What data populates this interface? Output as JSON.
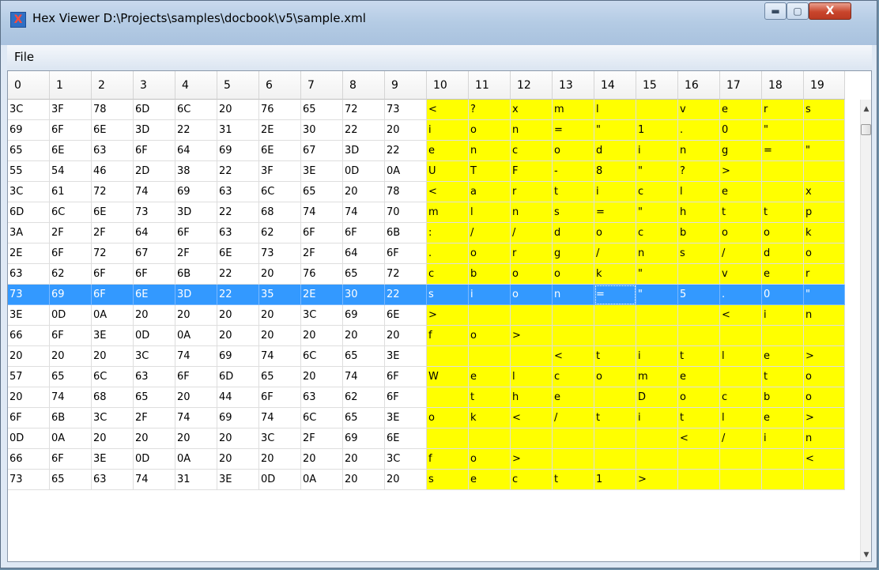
{
  "window": {
    "title": "Hex Viewer D:\\Projects\\samples\\docbook\\v5\\sample.xml",
    "icon": "app-x-icon",
    "buttons": {
      "minimize": "▬",
      "maximize": "▢",
      "close": "X"
    }
  },
  "menu": {
    "items": [
      {
        "label": "File"
      }
    ]
  },
  "grid": {
    "columns": [
      "0",
      "1",
      "2",
      "3",
      "4",
      "5",
      "6",
      "7",
      "8",
      "9",
      "10",
      "11",
      "12",
      "13",
      "14",
      "15",
      "16",
      "17",
      "18",
      "19"
    ],
    "selected_row_index": 9,
    "focused_column": 14,
    "colors": {
      "ascii_bg": "#ffff00",
      "selected_bg": "#3399ff"
    },
    "rows": [
      {
        "hex": [
          "3C",
          "3F",
          "78",
          "6D",
          "6C",
          "20",
          "76",
          "65",
          "72",
          "73"
        ],
        "ascii": [
          "<",
          "?",
          "x",
          "m",
          "l",
          "",
          "v",
          "e",
          "r",
          "s"
        ]
      },
      {
        "hex": [
          "69",
          "6F",
          "6E",
          "3D",
          "22",
          "31",
          "2E",
          "30",
          "22",
          "20"
        ],
        "ascii": [
          "i",
          "o",
          "n",
          "=",
          "\"",
          "1",
          ".",
          "0",
          "\"",
          ""
        ]
      },
      {
        "hex": [
          "65",
          "6E",
          "63",
          "6F",
          "64",
          "69",
          "6E",
          "67",
          "3D",
          "22"
        ],
        "ascii": [
          "e",
          "n",
          "c",
          "o",
          "d",
          "i",
          "n",
          "g",
          "=",
          "\""
        ]
      },
      {
        "hex": [
          "55",
          "54",
          "46",
          "2D",
          "38",
          "22",
          "3F",
          "3E",
          "0D",
          "0A"
        ],
        "ascii": [
          "U",
          "T",
          "F",
          "-",
          "8",
          "\"",
          "?",
          ">",
          "",
          ""
        ]
      },
      {
        "hex": [
          "3C",
          "61",
          "72",
          "74",
          "69",
          "63",
          "6C",
          "65",
          "20",
          "78"
        ],
        "ascii": [
          "<",
          "a",
          "r",
          "t",
          "i",
          "c",
          "l",
          "e",
          "",
          "x"
        ]
      },
      {
        "hex": [
          "6D",
          "6C",
          "6E",
          "73",
          "3D",
          "22",
          "68",
          "74",
          "74",
          "70"
        ],
        "ascii": [
          "m",
          "l",
          "n",
          "s",
          "=",
          "\"",
          "h",
          "t",
          "t",
          "p"
        ]
      },
      {
        "hex": [
          "3A",
          "2F",
          "2F",
          "64",
          "6F",
          "63",
          "62",
          "6F",
          "6F",
          "6B"
        ],
        "ascii": [
          ":",
          "/",
          "/",
          "d",
          "o",
          "c",
          "b",
          "o",
          "o",
          "k"
        ]
      },
      {
        "hex": [
          "2E",
          "6F",
          "72",
          "67",
          "2F",
          "6E",
          "73",
          "2F",
          "64",
          "6F"
        ],
        "ascii": [
          ".",
          "o",
          "r",
          "g",
          "/",
          "n",
          "s",
          "/",
          "d",
          "o"
        ]
      },
      {
        "hex": [
          "63",
          "62",
          "6F",
          "6F",
          "6B",
          "22",
          "20",
          "76",
          "65",
          "72"
        ],
        "ascii": [
          "c",
          "b",
          "o",
          "o",
          "k",
          "\"",
          "",
          "v",
          "e",
          "r"
        ]
      },
      {
        "hex": [
          "73",
          "69",
          "6F",
          "6E",
          "3D",
          "22",
          "35",
          "2E",
          "30",
          "22"
        ],
        "ascii": [
          "s",
          "i",
          "o",
          "n",
          "=",
          "\"",
          "5",
          ".",
          "0",
          "\""
        ]
      },
      {
        "hex": [
          "3E",
          "0D",
          "0A",
          "20",
          "20",
          "20",
          "20",
          "3C",
          "69",
          "6E"
        ],
        "ascii": [
          ">",
          "",
          "",
          "",
          "",
          "",
          "",
          "<",
          "i",
          "n"
        ]
      },
      {
        "hex": [
          "66",
          "6F",
          "3E",
          "0D",
          "0A",
          "20",
          "20",
          "20",
          "20",
          "20"
        ],
        "ascii": [
          "f",
          "o",
          ">",
          "",
          "",
          "",
          "",
          "",
          "",
          ""
        ]
      },
      {
        "hex": [
          "20",
          "20",
          "20",
          "3C",
          "74",
          "69",
          "74",
          "6C",
          "65",
          "3E"
        ],
        "ascii": [
          "",
          "",
          "",
          "<",
          "t",
          "i",
          "t",
          "l",
          "e",
          ">"
        ]
      },
      {
        "hex": [
          "57",
          "65",
          "6C",
          "63",
          "6F",
          "6D",
          "65",
          "20",
          "74",
          "6F"
        ],
        "ascii": [
          "W",
          "e",
          "l",
          "c",
          "o",
          "m",
          "e",
          "",
          "t",
          "o"
        ]
      },
      {
        "hex": [
          "20",
          "74",
          "68",
          "65",
          "20",
          "44",
          "6F",
          "63",
          "62",
          "6F"
        ],
        "ascii": [
          "",
          "t",
          "h",
          "e",
          "",
          "D",
          "o",
          "c",
          "b",
          "o"
        ]
      },
      {
        "hex": [
          "6F",
          "6B",
          "3C",
          "2F",
          "74",
          "69",
          "74",
          "6C",
          "65",
          "3E"
        ],
        "ascii": [
          "o",
          "k",
          "<",
          "/",
          "t",
          "i",
          "t",
          "l",
          "e",
          ">"
        ]
      },
      {
        "hex": [
          "0D",
          "0A",
          "20",
          "20",
          "20",
          "20",
          "3C",
          "2F",
          "69",
          "6E"
        ],
        "ascii": [
          "",
          "",
          "",
          "",
          "",
          "",
          "<",
          "/",
          "i",
          "n"
        ]
      },
      {
        "hex": [
          "66",
          "6F",
          "3E",
          "0D",
          "0A",
          "20",
          "20",
          "20",
          "20",
          "3C"
        ],
        "ascii": [
          "f",
          "o",
          ">",
          "",
          "",
          "",
          "",
          "",
          "",
          "<"
        ]
      },
      {
        "hex": [
          "73",
          "65",
          "63",
          "74",
          "31",
          "3E",
          "0D",
          "0A",
          "20",
          "20"
        ],
        "ascii": [
          "s",
          "e",
          "c",
          "t",
          "1",
          ">",
          "",
          "",
          "",
          ""
        ]
      }
    ]
  },
  "scrollbar": {
    "up_icon": "scroll-up-arrow-icon",
    "down_icon": "scroll-down-arrow-icon",
    "up_glyph": "▲",
    "down_glyph": "▼"
  }
}
